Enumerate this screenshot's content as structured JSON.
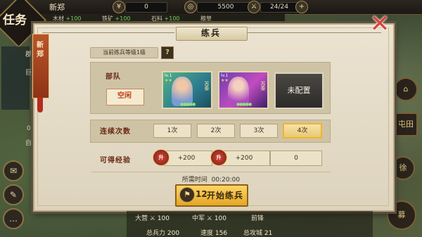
{
  "top": {
    "city": "新郑",
    "res1": "0",
    "res2": "5500",
    "troops": "24/24",
    "sub": [
      {
        "label": "木材",
        "value": "+100"
      },
      {
        "label": "铁矿",
        "value": "+100"
      },
      {
        "label": "石料",
        "value": "+100"
      },
      {
        "label": "粮草",
        "value": ""
      }
    ]
  },
  "side": {
    "task": "任务",
    "left_partial": [
      "郡",
      "巨",
      "0",
      "自"
    ],
    "right_partial": [
      "屯田",
      "徐"
    ]
  },
  "modal": {
    "title": "练兵",
    "city_tab": "新郑",
    "level_label": "当前练兵等级1级",
    "help": "?",
    "troop_label": "部队",
    "idle_label": "空闲",
    "generals": [
      {
        "level": "lv.1",
        "name": "苏秦",
        "face_color": "#7b9ad0"
      },
      {
        "level": "lv.1",
        "name": "苏秦",
        "face_color": "#b04bc0"
      }
    ],
    "unconfigured_label": "未配置",
    "count_label": "连续次数",
    "count_options": [
      "1次",
      "2次",
      "3次",
      "4次"
    ],
    "count_selected": 3,
    "exp_label": "可得经验",
    "exp_icon_text": "升",
    "exp_values": [
      "+200",
      "+200",
      "0"
    ],
    "time_label": "所需时间",
    "time_value": "00:20:00",
    "start_cost": "12",
    "start_label": "开始练兵"
  },
  "bottom": {
    "da_ying": "大营",
    "da_ying_val": "100",
    "zhong_jun": "中军",
    "zhong_jun_val": "100",
    "qian_feng": "前锋",
    "total_force_label": "总兵力",
    "total_force_val": "200",
    "speed_label": "速度",
    "speed_val": "156",
    "siege_label": "总攻城",
    "siege_val": "21"
  },
  "colors": {
    "accent_gold": "#f0b42e",
    "close_red": "#d9443a",
    "label_brown": "#6a2a14"
  }
}
